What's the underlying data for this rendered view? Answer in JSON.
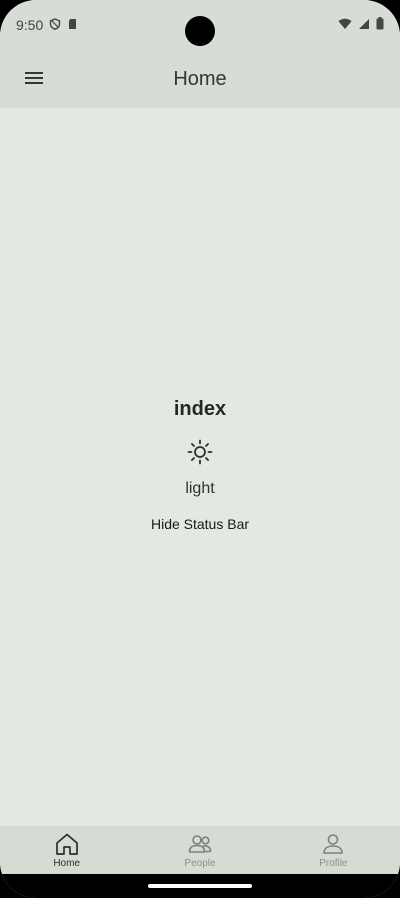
{
  "status_bar": {
    "time": "9:50",
    "left_icons": [
      "shield-icon",
      "sd-card-icon"
    ],
    "right_icons": [
      "wifi-icon",
      "signal-icon",
      "battery-icon"
    ]
  },
  "app_bar": {
    "menu_icon": "hamburger-menu-icon",
    "title": "Home"
  },
  "main": {
    "index_title": "index",
    "theme_icon": "sun-icon",
    "theme_label": "light",
    "hide_status_label": "Hide Status Bar"
  },
  "bottom_nav": {
    "items": [
      {
        "label": "Home",
        "icon": "home-icon",
        "active": true
      },
      {
        "label": "People",
        "icon": "people-icon",
        "active": false
      },
      {
        "label": "Profile",
        "icon": "profile-icon",
        "active": false
      }
    ]
  },
  "colors": {
    "background": "#e3e9e1",
    "bar": "#d7ddd4",
    "text_dark": "#222a22",
    "inactive": "#8a928a"
  }
}
